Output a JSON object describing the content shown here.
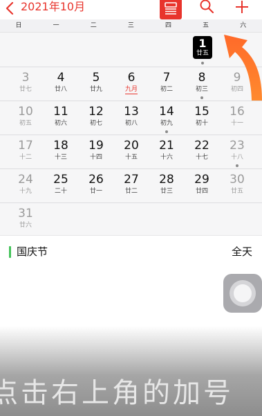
{
  "header": {
    "month_title": "2021年10月",
    "back_icon": "chevron-left-icon",
    "list_icon": "list-view-icon",
    "search_icon": "search-icon",
    "add_icon": "plus-icon",
    "accent_color": "#e8342c"
  },
  "weekdays": [
    "日",
    "一",
    "二",
    "三",
    "四",
    "五",
    "六"
  ],
  "calendar": {
    "selected_day": {
      "num": "1",
      "lunar": "廿五"
    },
    "weeks": [
      [
        {
          "num": "3",
          "lunar": "廿七"
        },
        {
          "num": "4",
          "lunar": "廿八"
        },
        {
          "num": "5",
          "lunar": "廿九"
        },
        {
          "num": "6",
          "lunar": "九月"
        },
        {
          "num": "7",
          "lunar": "初二"
        },
        {
          "num": "8",
          "lunar": "初三"
        },
        {
          "num": "9",
          "lunar": "初四"
        }
      ],
      [
        {
          "num": "10",
          "lunar": "初五"
        },
        {
          "num": "11",
          "lunar": "初六"
        },
        {
          "num": "12",
          "lunar": "初七"
        },
        {
          "num": "13",
          "lunar": "初八"
        },
        {
          "num": "14",
          "lunar": "初九"
        },
        {
          "num": "15",
          "lunar": "初十"
        },
        {
          "num": "16",
          "lunar": "十一"
        }
      ],
      [
        {
          "num": "17",
          "lunar": "十二"
        },
        {
          "num": "18",
          "lunar": "十三"
        },
        {
          "num": "19",
          "lunar": "十四"
        },
        {
          "num": "20",
          "lunar": "十五"
        },
        {
          "num": "21",
          "lunar": "十六"
        },
        {
          "num": "22",
          "lunar": "十七"
        },
        {
          "num": "23",
          "lunar": "十八"
        }
      ],
      [
        {
          "num": "24",
          "lunar": "十九"
        },
        {
          "num": "25",
          "lunar": "二十"
        },
        {
          "num": "26",
          "lunar": "廿一"
        },
        {
          "num": "27",
          "lunar": "廿二"
        },
        {
          "num": "28",
          "lunar": "廿三"
        },
        {
          "num": "29",
          "lunar": "廿四"
        },
        {
          "num": "30",
          "lunar": "廿五"
        }
      ],
      [
        {
          "num": "31",
          "lunar": "廿六"
        }
      ]
    ]
  },
  "event": {
    "title": "国庆节",
    "time": "全天",
    "color": "#44c35a"
  },
  "assistive_touch_icon": "assistive-touch-icon",
  "subtitle": "点击右上角的加号"
}
